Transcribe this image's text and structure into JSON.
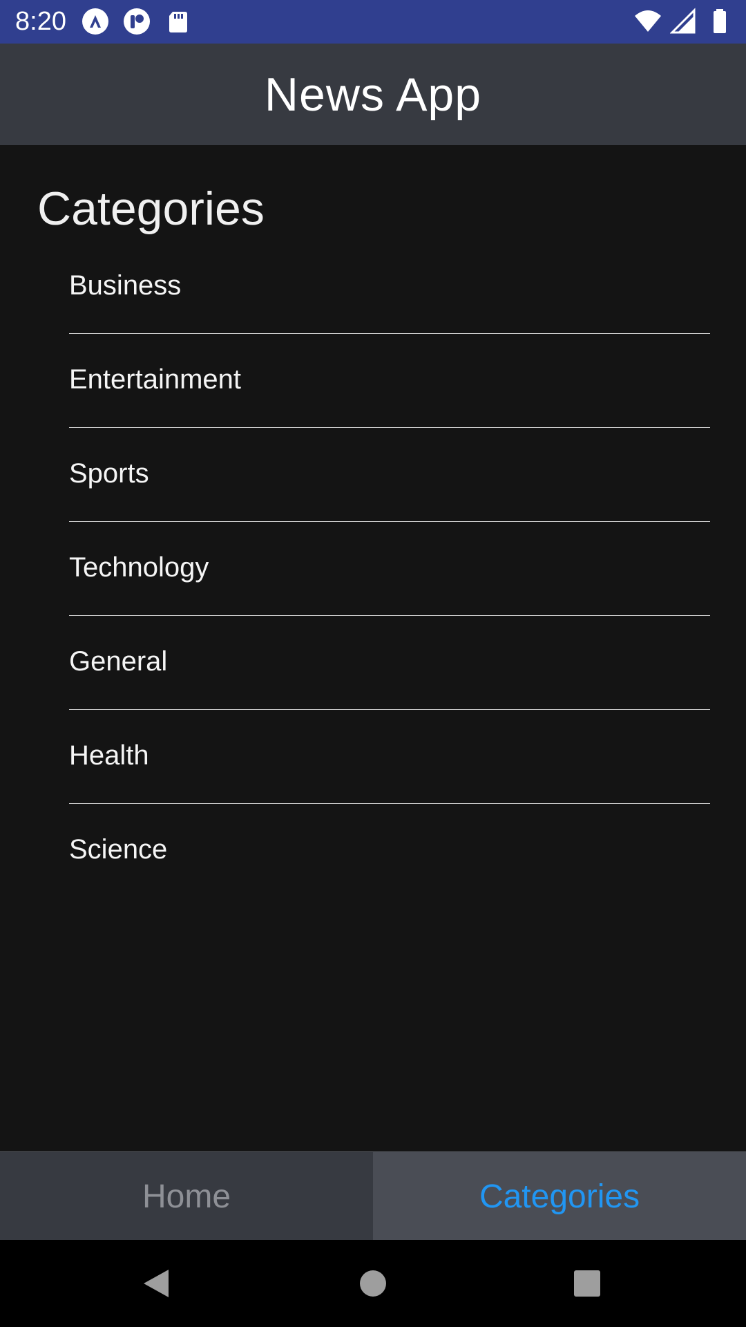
{
  "status_bar": {
    "time": "8:20",
    "left_icons": [
      "vpn-icon",
      "app-notification-icon",
      "sd-card-icon"
    ],
    "right_icons": [
      "wifi-icon",
      "signal-icon",
      "battery-icon"
    ],
    "background": "#303f8f"
  },
  "app_bar": {
    "title": "News App",
    "background": "#373a41"
  },
  "main": {
    "section_title": "Categories",
    "categories": [
      {
        "label": "Business"
      },
      {
        "label": "Entertainment"
      },
      {
        "label": "Sports"
      },
      {
        "label": "Technology"
      },
      {
        "label": "General"
      },
      {
        "label": "Health"
      },
      {
        "label": "Science"
      }
    ]
  },
  "tab_bar": {
    "tabs": [
      {
        "label": "Home",
        "active": false
      },
      {
        "label": "Categories",
        "active": true
      }
    ],
    "active_color": "#2196f3",
    "inactive_color": "#8e9096"
  },
  "nav_bar": {
    "buttons": [
      "back-icon",
      "home-icon",
      "recents-icon"
    ]
  }
}
